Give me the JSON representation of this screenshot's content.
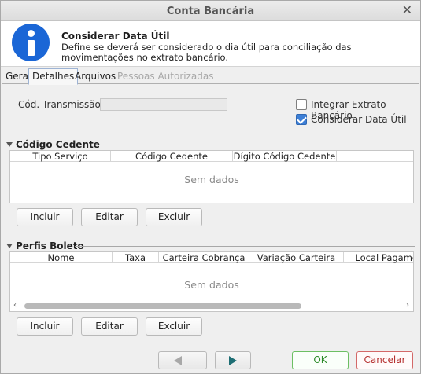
{
  "window": {
    "title": "Conta Bancária",
    "close_glyph": "✕"
  },
  "info": {
    "icon": "info-icon",
    "title": "Considerar Data Útil",
    "description": "Define se deverá ser considerado o dia útil para conciliação das movimentações no extrato bancário."
  },
  "tabs": [
    {
      "label": "Geral",
      "state": "normal"
    },
    {
      "label": "Detalhes",
      "state": "active"
    },
    {
      "label": "Arquivos",
      "state": "normal"
    },
    {
      "label": "Pessoas Autorizadas",
      "state": "disabled"
    }
  ],
  "form": {
    "cod_transmissao_label": "Cód. Transmissão",
    "cod_transmissao_value": "",
    "integrar_extrato_label": "Integrar Extrato Bancário",
    "integrar_extrato_checked": false,
    "considerar_data_util_label": "Considerar Data Útil",
    "considerar_data_util_checked": true
  },
  "codigo_cedente": {
    "section_title": "Código Cedente",
    "columns": [
      "Tipo Serviço",
      "Código Cedente",
      "Dígito Código Cedente"
    ],
    "rows": [],
    "empty_text": "Sem dados",
    "buttons": {
      "incluir": "Incluir",
      "editar": "Editar",
      "excluir": "Excluir"
    }
  },
  "perfis_boleto": {
    "section_title": "Perfis Boleto",
    "columns": [
      "Nome",
      "Taxa",
      "Carteira Cobrança",
      "Variação Carteira",
      "Local Pagame"
    ],
    "rows": [],
    "empty_text": "Sem dados",
    "buttons": {
      "incluir": "Incluir",
      "editar": "Editar",
      "excluir": "Excluir"
    }
  },
  "footer": {
    "prev_icon": "triangle-left-icon",
    "next_icon": "triangle-right-icon",
    "ok_label": "OK",
    "cancel_label": "Cancelar"
  },
  "colors": {
    "info_icon": "#1a66d6",
    "checkbox_checked": "#3d7fd6",
    "ok_border": "#6cbf63",
    "cancel_border": "#d36868",
    "next_arrow": "#1e6e74"
  }
}
